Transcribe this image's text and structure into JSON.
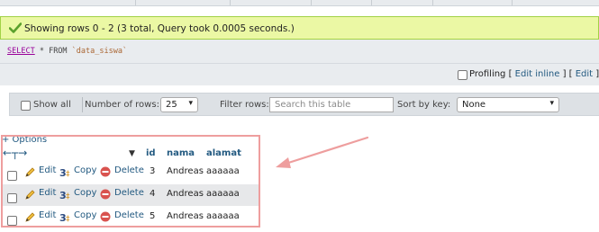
{
  "status": {
    "message": "Showing rows 0 - 2 (3 total, Query took 0.0005 seconds.)",
    "color": "#ebf8a4"
  },
  "query": {
    "select_kw": "SELECT",
    "rest": " * FROM ",
    "table": "`data_siswa`"
  },
  "profiling": {
    "label": "Profiling",
    "links": [
      "Edit inline",
      "Edit",
      "Ex"
    ]
  },
  "navigation": {
    "show_all_label": "Show all",
    "num_rows_label": "Number of rows:",
    "num_rows_value": "25",
    "filter_label": "Filter rows:",
    "filter_placeholder": "Search this table",
    "sort_label": "Sort by key:",
    "sort_value": "None"
  },
  "results": {
    "options_label": "+ Options",
    "columns": [
      "id",
      "nama",
      "alamat"
    ],
    "actions": {
      "edit": "Edit",
      "copy": "Copy",
      "delete": "Delete"
    },
    "rows": [
      {
        "id": "3",
        "nama": "Andreas",
        "alamat": "aaaaaa"
      },
      {
        "id": "4",
        "nama": "Andreas",
        "alamat": "aaaaaa"
      },
      {
        "id": "5",
        "nama": "Andreas",
        "alamat": "aaaaaa"
      }
    ]
  },
  "colors": {
    "link": "#235a81",
    "highlight": "#ee9e9e",
    "delete_icon": "#d9534f"
  }
}
